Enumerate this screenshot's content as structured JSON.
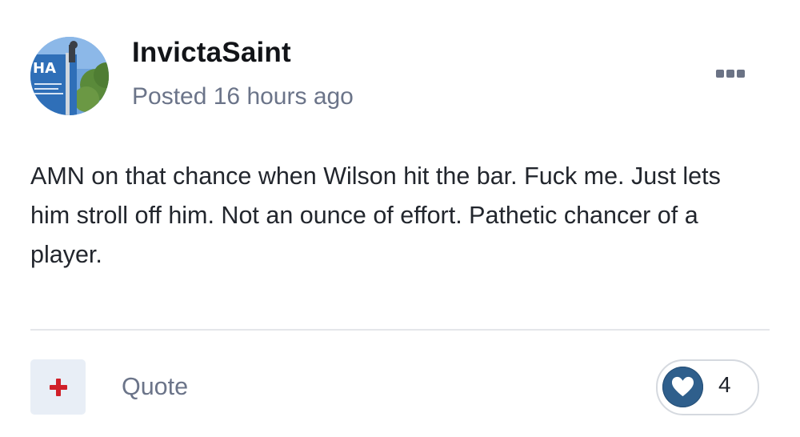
{
  "post": {
    "author": "InvictaSaint",
    "posted": "Posted 16 hours ago",
    "content": "AMN on that chance when Wilson hit the bar. Fuck me. Just lets him stroll off him. Not an ounce of effort. Pathetic chancer of a player.",
    "avatar_sign_text": "HA"
  },
  "actions": {
    "more_icon": "more-options-icon",
    "plus_icon": "plus-icon",
    "quote_label": "Quote",
    "reaction_icon": "heart-icon",
    "reaction_count": "4"
  },
  "colors": {
    "accent_red": "#d01f28",
    "reaction_blue": "#2f5f8c",
    "meta_gray": "#6b7489"
  }
}
